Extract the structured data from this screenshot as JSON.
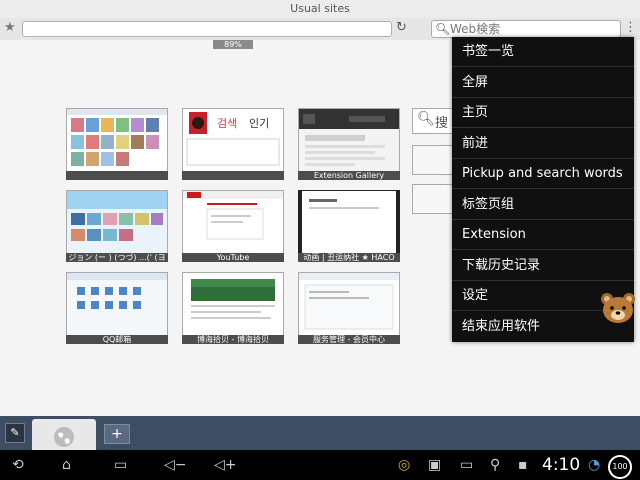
{
  "titlebar": {
    "title": "Usual sites"
  },
  "toolbar": {
    "bookmark_icon": "star-icon",
    "url_value": "",
    "reload_icon": "reload-icon",
    "search_placeholder": "Web検索",
    "overflow_icon": "overflow-menu-icon"
  },
  "zoom": {
    "level": "89%"
  },
  "thumbnails": [
    {
      "caption": ""
    },
    {
      "caption": ""
    },
    {
      "caption": "Extension Gallery"
    },
    {
      "caption": "ジョン (ー ) (つづ) ...(' (ヨ"
    },
    {
      "caption": "YouTube"
    },
    {
      "caption": "动画 | 丑运纳社 ★ HACO"
    },
    {
      "caption": "QQ邮箱"
    },
    {
      "caption": "博海拾贝 - 博海拾贝"
    },
    {
      "caption": "服务管理 - 会员中心"
    }
  ],
  "naver_tabs": {
    "search": "검색",
    "popular": "인기"
  },
  "side_search": {
    "text": "搜"
  },
  "menu": {
    "items": [
      {
        "label": "书签一览"
      },
      {
        "label": "全屏"
      },
      {
        "label": "主页"
      },
      {
        "label": "前进"
      },
      {
        "label": "Pickup and search words"
      },
      {
        "label": "标签页组"
      },
      {
        "label": "Extension"
      },
      {
        "label": "下载历史记录"
      },
      {
        "label": "设定"
      },
      {
        "label": "结束应用软件"
      }
    ]
  },
  "tabbar": {
    "new_tab_label": "+"
  },
  "statusbar": {
    "time": "4:10",
    "battery": "100"
  },
  "colors": {
    "menu_bg": "#101010",
    "tabbar_bg": "#3d4d62",
    "time": "#ffffff"
  }
}
